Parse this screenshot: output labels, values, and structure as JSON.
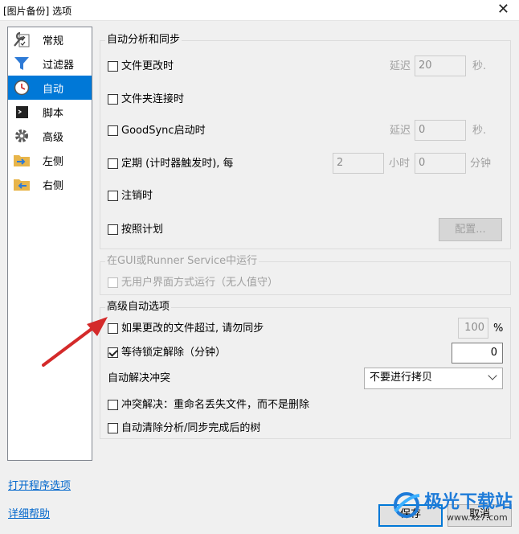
{
  "window": {
    "title": "[图片备份] 选项",
    "close_icon": "close-icon"
  },
  "sidebar": {
    "items": [
      {
        "label": "常规",
        "icon": "wrench-checklist-icon"
      },
      {
        "label": "过滤器",
        "icon": "funnel-icon"
      },
      {
        "label": "自动",
        "icon": "clock-icon"
      },
      {
        "label": "脚本",
        "icon": "script-icon"
      },
      {
        "label": "高级",
        "icon": "gear-icon"
      },
      {
        "label": "左侧",
        "icon": "folder-right-arrow-icon"
      },
      {
        "label": "右侧",
        "icon": "folder-left-arrow-icon"
      }
    ],
    "selected": "自动"
  },
  "links": {
    "open_options": "打开程序选项",
    "help": "详细帮助"
  },
  "auto_sync": {
    "legend": "自动分析和同步",
    "file_changed": {
      "label": "文件更改时",
      "checked": false,
      "delay_label": "延迟",
      "delay_value": "20",
      "unit": "秒."
    },
    "folder_connected": {
      "label": "文件夹连接时",
      "checked": false
    },
    "on_startup": {
      "label": "GoodSync启动时",
      "checked": false,
      "delay_label": "延迟",
      "delay_value": "0",
      "unit": "秒."
    },
    "periodic": {
      "label": "定期 (计时器触发时), 每",
      "checked": false,
      "hours_value": "2",
      "hours_label": "小时",
      "minutes_value": "0",
      "minutes_label": "分钟"
    },
    "on_logoff": {
      "label": "注销时",
      "checked": false
    },
    "scheduled": {
      "label": "按照计划",
      "checked": false,
      "configure_label": "配置..."
    }
  },
  "service": {
    "legend": "在GUI或Runner Service中运行",
    "headless": {
      "label": "无用户界面方式运行（无人值守）",
      "checked": false
    }
  },
  "advanced": {
    "legend": "高级自动选项",
    "skip_if_changed": {
      "label": "如果更改的文件超过, 请勿同步",
      "checked": false,
      "value": "100",
      "unit": "%"
    },
    "wait_unlock": {
      "label": "等待锁定解除（分钟）",
      "checked": true,
      "value": "0"
    },
    "conflict": {
      "label": "自动解决冲突",
      "selected": "不要进行拷贝"
    },
    "rename_lost": {
      "label": "冲突解决：重命名丢失文件，而不是删除",
      "checked": false
    },
    "auto_clear": {
      "label": "自动清除分析/同步完成后的树",
      "checked": false
    }
  },
  "buttons": {
    "save": "保存",
    "cancel": "取消"
  },
  "watermark": {
    "text": "极光下载站",
    "url": "www.xz7.com"
  },
  "colors": {
    "selection": "#0078d7",
    "link": "#0066cc",
    "arrow": "#d42a2a"
  }
}
